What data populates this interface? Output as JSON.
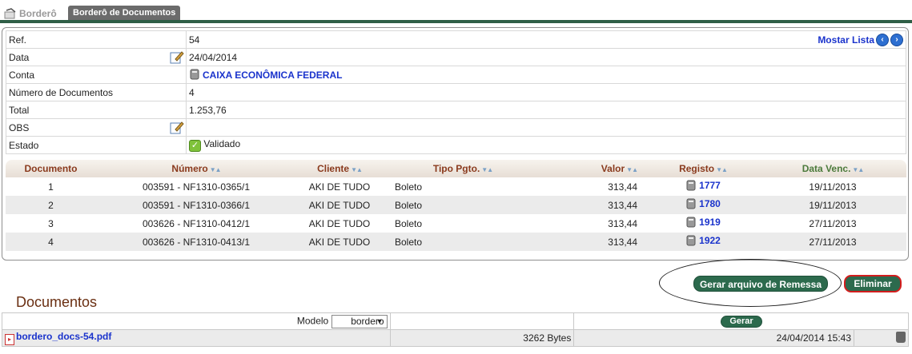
{
  "tabs": [
    {
      "label": "Borderô",
      "active": false
    },
    {
      "label": "Borderô de Documentos",
      "active": true
    }
  ],
  "info": {
    "rows": [
      {
        "label": "Ref.",
        "value": "54"
      },
      {
        "label": "Data",
        "value": "24/04/2014"
      },
      {
        "label": "Conta",
        "value": "CAIXA ECONÔMICA FEDERAL"
      },
      {
        "label": "Número de Documentos",
        "value": "4"
      },
      {
        "label": "Total",
        "value": "1.253,76"
      },
      {
        "label": "OBS",
        "value": ""
      },
      {
        "label": "Estado",
        "value": "Validado"
      }
    ],
    "mostrar_lista": "Mostar Lista"
  },
  "documents_table": {
    "headers": [
      "Documento",
      "Número",
      "Cliente",
      "Tipo Pgto.",
      "Valor",
      "Registo",
      "Data Venc."
    ],
    "rows": [
      [
        "1",
        "003591 - NF1310-0365/1",
        "AKI DE TUDO",
        "Boleto",
        "313,44",
        "1777",
        "19/11/2013"
      ],
      [
        "2",
        "003591 - NF1310-0366/1",
        "AKI DE TUDO",
        "Boleto",
        "313,44",
        "1780",
        "19/11/2013"
      ],
      [
        "3",
        "003626 - NF1310-0412/1",
        "AKI DE TUDO",
        "Boleto",
        "313,44",
        "1919",
        "27/11/2013"
      ],
      [
        "4",
        "003626 - NF1310-0413/1",
        "AKI DE TUDO",
        "Boleto",
        "313,44",
        "1922",
        "27/11/2013"
      ]
    ]
  },
  "actions": {
    "gerar_arquivo": "Gerar arquivo de Remessa",
    "eliminar": "Eliminar"
  },
  "documentos": {
    "title": "Documentos",
    "modelo_label": "Modelo",
    "modelo_value": "bordero",
    "gerar_label": "Gerar",
    "file": {
      "name": "bordero_docs-54.pdf",
      "size": "3262 Bytes",
      "date": "24/04/2014 15:43"
    }
  },
  "colors": {
    "tab_bar": "#2e5e46",
    "button": "#2c6a4d",
    "eliminar_border": "#d21d1d",
    "link": "#1a33cc",
    "header_brown": "#8a3a1d",
    "header_green": "#4c7a3b"
  }
}
